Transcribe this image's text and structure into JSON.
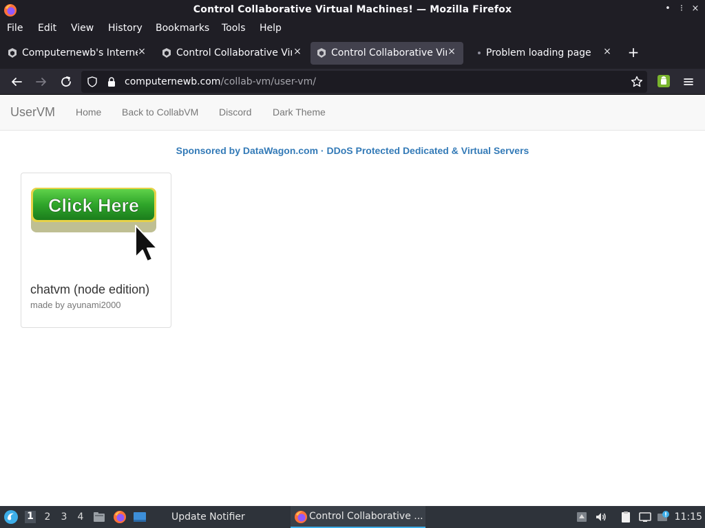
{
  "window": {
    "title": "Control Collaborative Virtual Machines! — Mozilla Firefox",
    "controls": [
      "•",
      "⁝",
      "×"
    ]
  },
  "menubar": {
    "items": [
      "File",
      "Edit",
      "View",
      "History",
      "Bookmarks",
      "Tools",
      "Help"
    ]
  },
  "tabs": [
    {
      "title": "Computernewb's Internet",
      "active": false
    },
    {
      "title": "Control Collaborative Virt",
      "active": false
    },
    {
      "title": "Control Collaborative Virt",
      "active": true
    },
    {
      "title": "Problem loading page",
      "active": false
    }
  ],
  "tab_close_glyph": "×",
  "new_tab_glyph": "+",
  "urlbar": {
    "domain": "computernewb.com",
    "path": "/collab-vm/user-vm/"
  },
  "site_nav": {
    "brand": "UserVM",
    "links": [
      "Home",
      "Back to CollabVM",
      "Discord",
      "Dark Theme"
    ]
  },
  "sponsor": {
    "text": "Sponsored by DataWagon.com · DDoS Protected Dedicated & Virtual Servers"
  },
  "vm_card": {
    "thumbnail_text": "Click Here",
    "name": "chatvm (node edition)",
    "author": "made by ayunami2000"
  },
  "taskbar": {
    "workspaces": [
      "1",
      "2",
      "3",
      "4"
    ],
    "active_workspace": "1",
    "tasks": [
      "Update Notifier",
      "Control Collaborative ..."
    ],
    "clock": "11:15"
  },
  "colors": {
    "titlebar_bg": "#1f1e25",
    "link_blue": "#337ab7",
    "button_green": "#2fa52a",
    "taskbar_accent": "#3daee9"
  }
}
